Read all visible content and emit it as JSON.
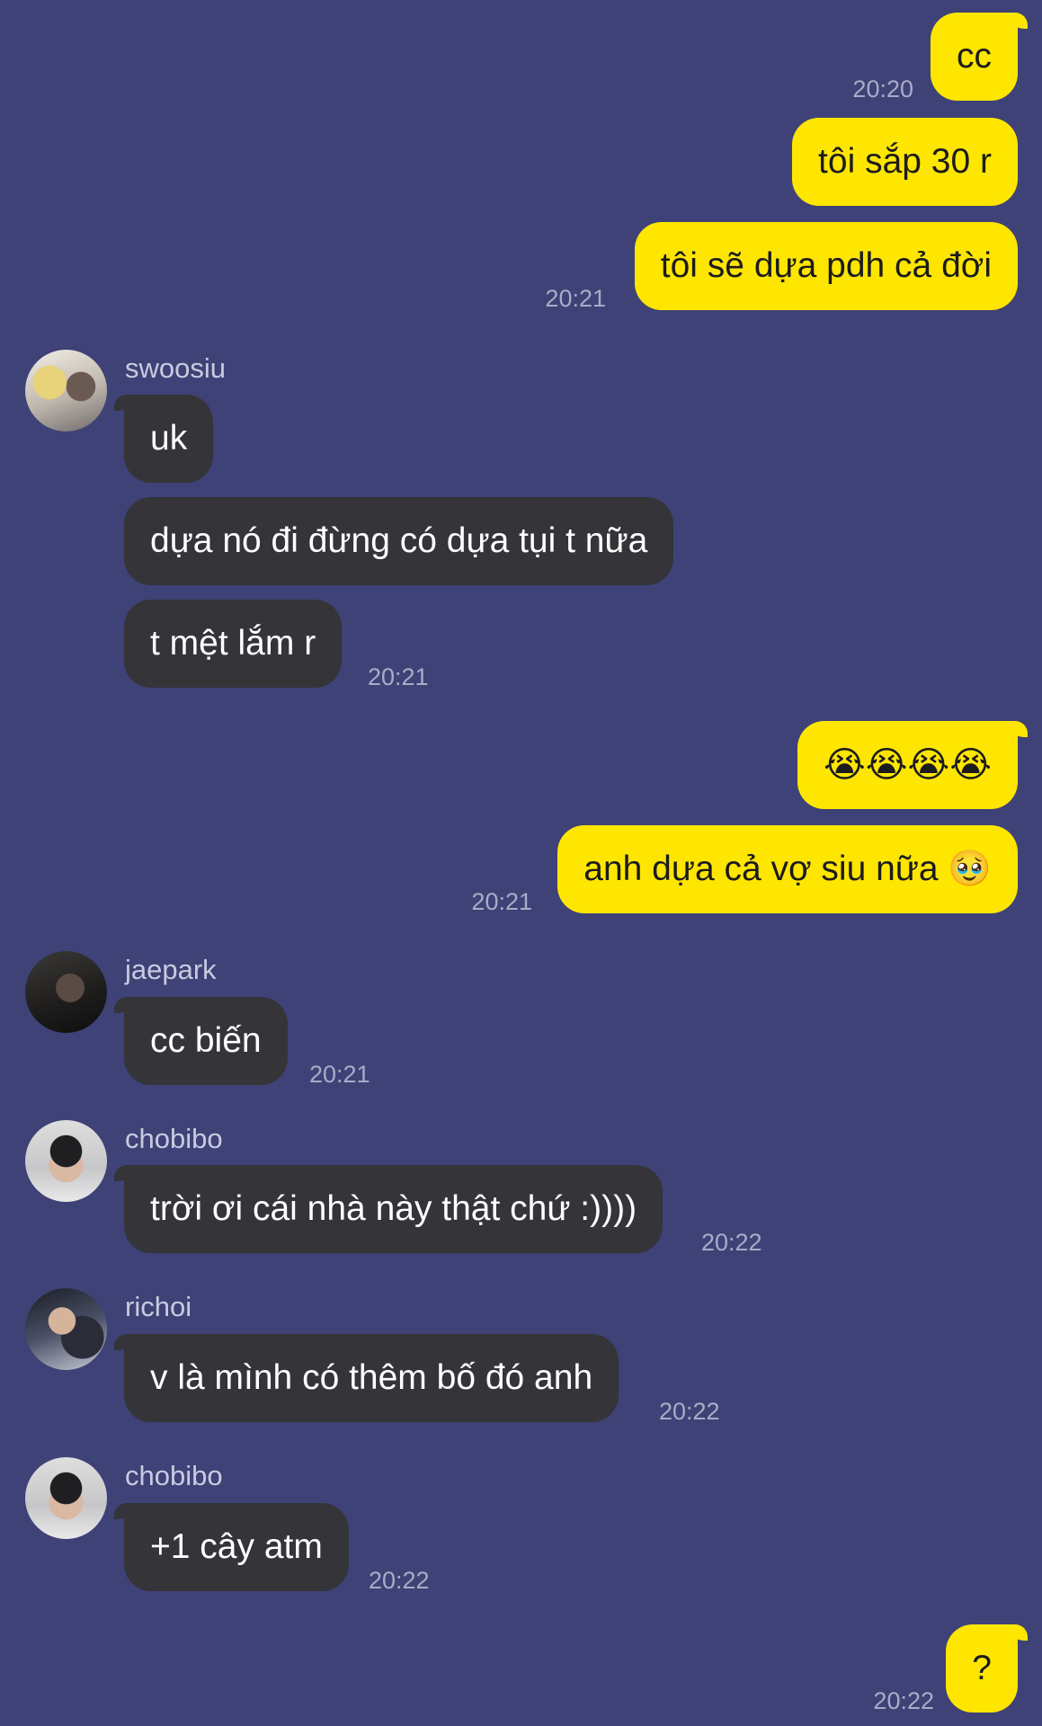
{
  "messages": [
    {
      "text": "cc",
      "time": "20:20"
    },
    {
      "text": "tôi sắp 30 r"
    },
    {
      "text": "tôi sẽ dựa pdh cả đời",
      "time": "20:21"
    },
    {
      "sender": "swoosiu",
      "text": "uk"
    },
    {
      "text": "dựa nó đi đừng có dựa tụi t nữa"
    },
    {
      "text": "t mệt lắm r",
      "time": "20:21"
    },
    {
      "text": "😭😭😭😭"
    },
    {
      "text": "anh dựa cả vợ siu nữa 🥹",
      "time": "20:21"
    },
    {
      "sender": "jaepark",
      "text": "cc biến",
      "time": "20:21"
    },
    {
      "sender": "chobibo",
      "text": "trời ơi cái nhà này thật chứ :))))",
      "time": "20:22"
    },
    {
      "sender": "richoi",
      "text": "v là mình có thêm bố đó anh",
      "time": "20:22"
    },
    {
      "sender": "chobibo",
      "text": "+1 cây atm",
      "time": "20:22"
    },
    {
      "text": "?",
      "time": "20:22"
    }
  ],
  "colors": {
    "background": "#3f4276",
    "outgoing_bubble": "#ffe600",
    "incoming_bubble": "#343439"
  },
  "avatars": [
    "avatar-swoosiu",
    "avatar-jaepark",
    "avatar-chobibo",
    "avatar-richoi",
    "avatar-chobibo"
  ]
}
